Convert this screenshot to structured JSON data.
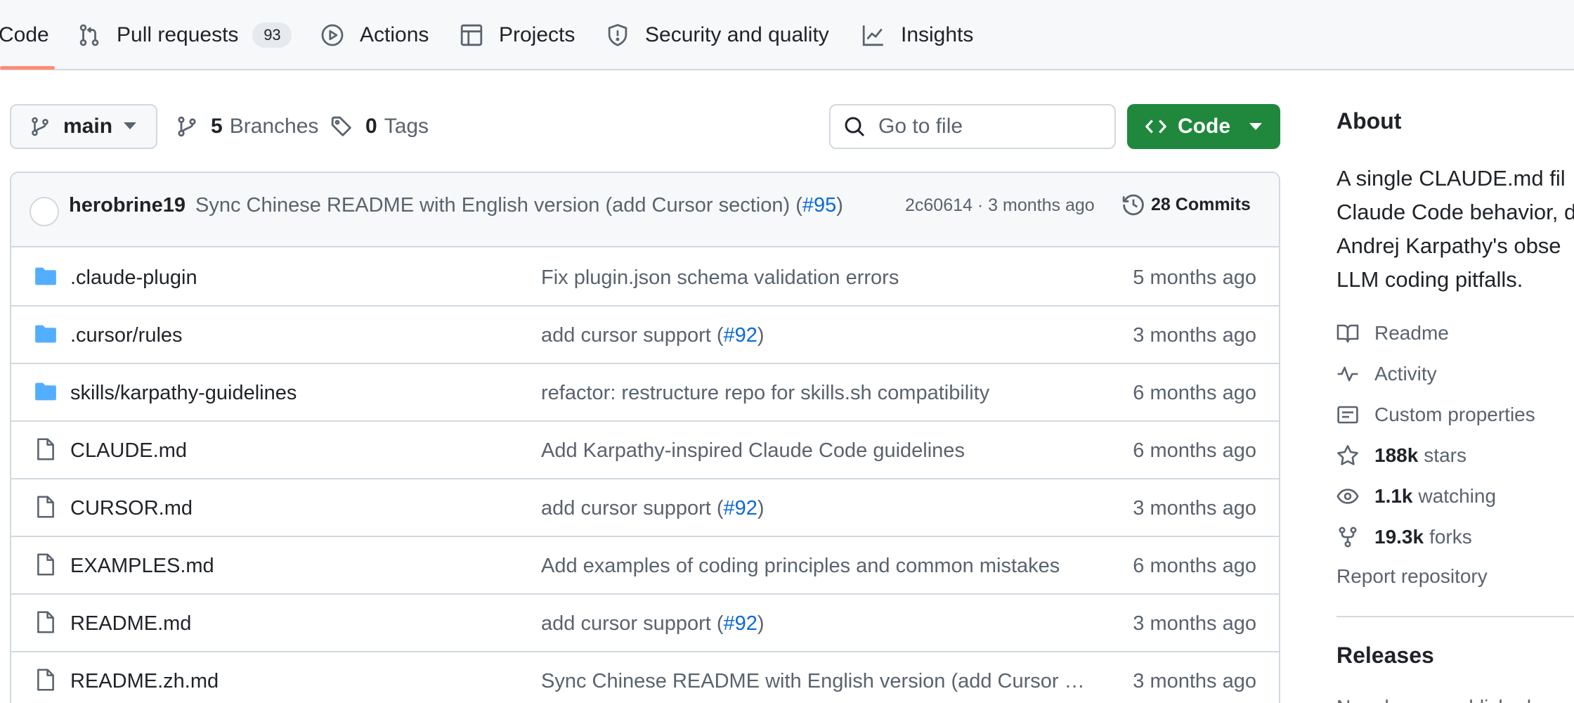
{
  "repo_nav": {
    "items": [
      {
        "label": "Code",
        "icon": "code-icon",
        "selected": true
      },
      {
        "label": "Pull requests",
        "icon": "git-pull-request-icon",
        "count": "93"
      },
      {
        "label": "Actions",
        "icon": "play-icon"
      },
      {
        "label": "Projects",
        "icon": "table-icon"
      },
      {
        "label": "Security and quality",
        "icon": "shield-icon"
      },
      {
        "label": "Insights",
        "icon": "graph-icon"
      }
    ],
    "selected_underline_color": "#fd8c73"
  },
  "toolbar": {
    "branch": "main",
    "branches_count": "5",
    "branches_label": "Branches",
    "tags_count": "0",
    "tags_label": "Tags",
    "search_placeholder": "Go to file",
    "code_button_label": "Code",
    "code_button_color": "#1f883d"
  },
  "latest_commit": {
    "author": "herobrine19",
    "message": "Sync Chinese README with English version (add Cursor section) (",
    "pr_link": "#95",
    "message_suffix": ")",
    "hash": "2c60614",
    "separator": "·",
    "time": "3 months ago",
    "commits_count": "28",
    "commits_label": "Commits"
  },
  "files": [
    {
      "type": "folder",
      "icon": "folder-icon",
      "name": ".claude-plugin",
      "message": "Fix plugin.json schema validation errors",
      "link": "",
      "suffix": "",
      "date": "5 months ago"
    },
    {
      "type": "folder",
      "icon": "folder-icon",
      "name": ".cursor/rules",
      "message": "add cursor support (",
      "link": "#92",
      "suffix": ")",
      "date": "3 months ago"
    },
    {
      "type": "folder",
      "icon": "folder-icon",
      "name": "skills/karpathy-guidelines",
      "message": "refactor: restructure repo for skills.sh compatibility",
      "link": "",
      "suffix": "",
      "date": "6 months ago"
    },
    {
      "type": "file",
      "icon": "file-icon",
      "name": "CLAUDE.md",
      "message": "Add Karpathy-inspired Claude Code guidelines",
      "link": "",
      "suffix": "",
      "date": "6 months ago"
    },
    {
      "type": "file",
      "icon": "file-icon",
      "name": "CURSOR.md",
      "message": "add cursor support (",
      "link": "#92",
      "suffix": ")",
      "date": "3 months ago"
    },
    {
      "type": "file",
      "icon": "file-icon",
      "name": "EXAMPLES.md",
      "message": "Add examples of coding principles and common mistakes",
      "link": "",
      "suffix": "",
      "date": "6 months ago"
    },
    {
      "type": "file",
      "icon": "file-icon",
      "name": "README.md",
      "message": "add cursor support (",
      "link": "#92",
      "suffix": ")",
      "date": "3 months ago"
    },
    {
      "type": "file",
      "icon": "file-icon",
      "name": "README.zh.md",
      "message": "Sync Chinese README with English version (add Cursor s…",
      "link": "",
      "suffix": "",
      "date": "3 months ago"
    }
  ],
  "about": {
    "title": "About",
    "description_lines": [
      "A single CLAUDE.md fil",
      "Claude Code behavior, d",
      "Andrej Karpathy's obse",
      "LLM coding pitfalls."
    ],
    "links": [
      {
        "icon": "book-icon",
        "value": "",
        "label": "Readme"
      },
      {
        "icon": "pulse-icon",
        "value": "",
        "label": "Activity"
      },
      {
        "icon": "note-icon",
        "value": "",
        "label": "Custom properties"
      },
      {
        "icon": "star-icon",
        "value": "188k",
        "label": "stars"
      },
      {
        "icon": "eye-icon",
        "value": "1.1k",
        "label": "watching"
      },
      {
        "icon": "repo-forked-icon",
        "value": "19.3k",
        "label": "forks"
      }
    ],
    "report": "Report repository"
  },
  "releases": {
    "title": "Releases",
    "note": "No releases published"
  },
  "colors": {
    "link": "#0969da",
    "folder": "#54aeff",
    "muted": "#59636e",
    "border": "#d1d9e0"
  }
}
